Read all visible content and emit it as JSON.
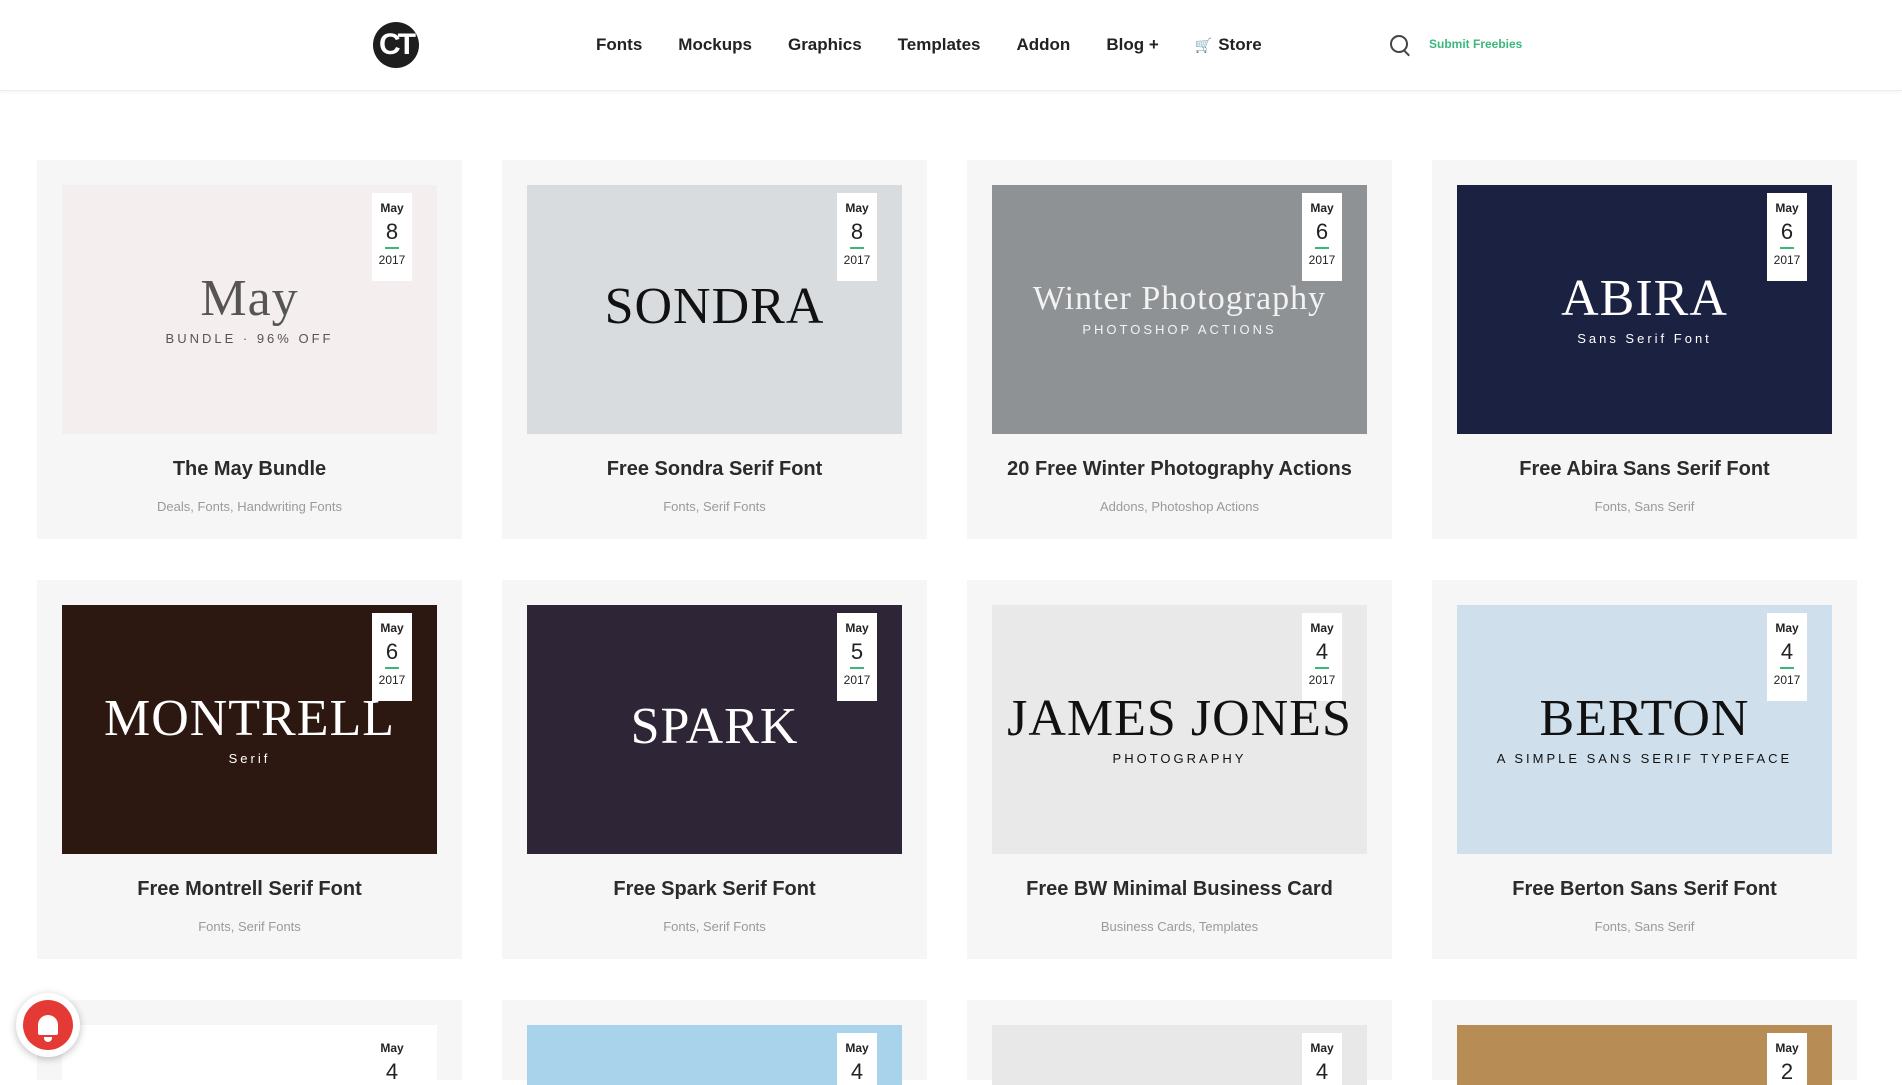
{
  "header": {
    "logo_text": "CT",
    "nav": [
      {
        "label": "Fonts",
        "icon": ""
      },
      {
        "label": "Mockups",
        "icon": ""
      },
      {
        "label": "Graphics",
        "icon": ""
      },
      {
        "label": "Templates",
        "icon": ""
      },
      {
        "label": "Addon",
        "icon": ""
      },
      {
        "label": "Blog +",
        "icon": ""
      },
      {
        "label": "Store",
        "icon": "cart-icon"
      }
    ],
    "search_icon": "search-icon",
    "submit_label": "Submit Freebies",
    "accent_color": "#3bb77e"
  },
  "posts": [
    {
      "title": "The May Bundle",
      "month": "May",
      "day": "8",
      "year": "2017",
      "categories": [
        "Deals",
        "Fonts",
        "Handwriting Fonts"
      ],
      "thumb_text": "May",
      "thumb_sub": "BUNDLE · 96% OFF",
      "thumb_bg": "#f4eeee",
      "thumb_fg": "#555555"
    },
    {
      "title": "Free Sondra Serif Font",
      "month": "May",
      "day": "8",
      "year": "2017",
      "categories": [
        "Fonts",
        "Serif Fonts"
      ],
      "thumb_text": "SONDRA",
      "thumb_sub": "",
      "thumb_bg": "#d9dcdf",
      "thumb_fg": "#111111"
    },
    {
      "title": "20 Free Winter Photography Actions",
      "month": "May",
      "day": "6",
      "year": "2017",
      "categories": [
        "Addons",
        "Photoshop Actions"
      ],
      "thumb_text": "Winter Photography",
      "thumb_sub": "PHOTOSHOP ACTIONS",
      "thumb_bg": "#8f9294",
      "thumb_fg": "#f2f2f2"
    },
    {
      "title": "Free Abira Sans Serif Font",
      "month": "May",
      "day": "6",
      "year": "2017",
      "categories": [
        "Fonts",
        "Sans Serif"
      ],
      "thumb_text": "ABIRA",
      "thumb_sub": "Sans Serif Font",
      "thumb_bg": "#1b2140",
      "thumb_fg": "#ffffff"
    },
    {
      "title": "Free Montrell Serif Font",
      "month": "May",
      "day": "6",
      "year": "2017",
      "categories": [
        "Fonts",
        "Serif Fonts"
      ],
      "thumb_text": "MONTRELL",
      "thumb_sub": "Serif",
      "thumb_bg": "#2c1810",
      "thumb_fg": "#ffffff"
    },
    {
      "title": "Free Spark Serif Font",
      "month": "May",
      "day": "5",
      "year": "2017",
      "categories": [
        "Fonts",
        "Serif Fonts"
      ],
      "thumb_text": "SPARK",
      "thumb_sub": "",
      "thumb_bg": "#2e2536",
      "thumb_fg": "#ffffff"
    },
    {
      "title": "Free BW Minimal Business Card",
      "month": "May",
      "day": "4",
      "year": "2017",
      "categories": [
        "Business Cards",
        "Templates"
      ],
      "thumb_text": "JAMES JONES",
      "thumb_sub": "PHOTOGRAPHY",
      "thumb_bg": "#e9e9e9",
      "thumb_fg": "#111111"
    },
    {
      "title": "Free Berton Sans Serif Font",
      "month": "May",
      "day": "4",
      "year": "2017",
      "categories": [
        "Fonts",
        "Sans Serif"
      ],
      "thumb_text": "BERTON",
      "thumb_sub": "A SIMPLE SANS SERIF TYPEFACE",
      "thumb_bg": "#cfe0ec",
      "thumb_fg": "#111111"
    }
  ],
  "partial_posts": [
    {
      "month": "May",
      "day": "4",
      "thumb_bg": "#ffffff"
    },
    {
      "month": "May",
      "day": "4",
      "thumb_bg": "#a9d3ea"
    },
    {
      "month": "May",
      "day": "4",
      "thumb_bg": "#e8e8e8"
    },
    {
      "month": "May",
      "day": "2",
      "thumb_bg": "#b88d55"
    }
  ],
  "notification_icon": "bell-icon"
}
